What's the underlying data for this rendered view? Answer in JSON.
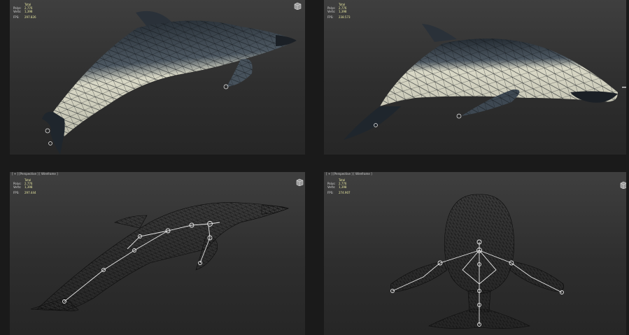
{
  "viewports": [
    {
      "id": "top-left",
      "label": "",
      "stats": {
        "total_label": "Total",
        "polys_label": "Polys:",
        "polys_value": "2,776",
        "verts_label": "Verts:",
        "verts_value": "1,398",
        "fps_label": "FPS:",
        "fps_value": "297.826"
      },
      "shading": "smooth-shaded"
    },
    {
      "id": "top-right",
      "label": "",
      "stats": {
        "total_label": "Total",
        "polys_label": "Polys:",
        "polys_value": "2,776",
        "verts_label": "Verts:",
        "verts_value": "1,398",
        "fps_label": "FPS:",
        "fps_value": "238.573"
      },
      "shading": "smooth-shaded"
    },
    {
      "id": "bottom-left",
      "label": "[ + ] [Perspective ] [ Wireframe ]",
      "stats": {
        "total_label": "Total",
        "polys_label": "Polys:",
        "polys_value": "2,776",
        "verts_label": "Verts:",
        "verts_value": "1,398",
        "fps_label": "FPS:",
        "fps_value": "297.444"
      },
      "shading": "wireframe"
    },
    {
      "id": "bottom-right",
      "label": "[ + ] [Perspective ] [ Wireframe ]",
      "stats": {
        "total_label": "Total",
        "polys_label": "Polys:",
        "polys_value": "2,776",
        "verts_label": "Verts:",
        "verts_value": "1,398",
        "fps_label": "FPS:",
        "fps_value": "274.907"
      },
      "shading": "wireframe"
    }
  ],
  "colors": {
    "viewport_bg": "#363636",
    "stats_text": "#e6e6a0",
    "mesh_wire": "#111111",
    "dolphin_back": "#3b4550",
    "dolphin_belly": "#d9d8c6",
    "bone": "#e8e8e8"
  },
  "icons": [
    "viewcube-icon"
  ]
}
